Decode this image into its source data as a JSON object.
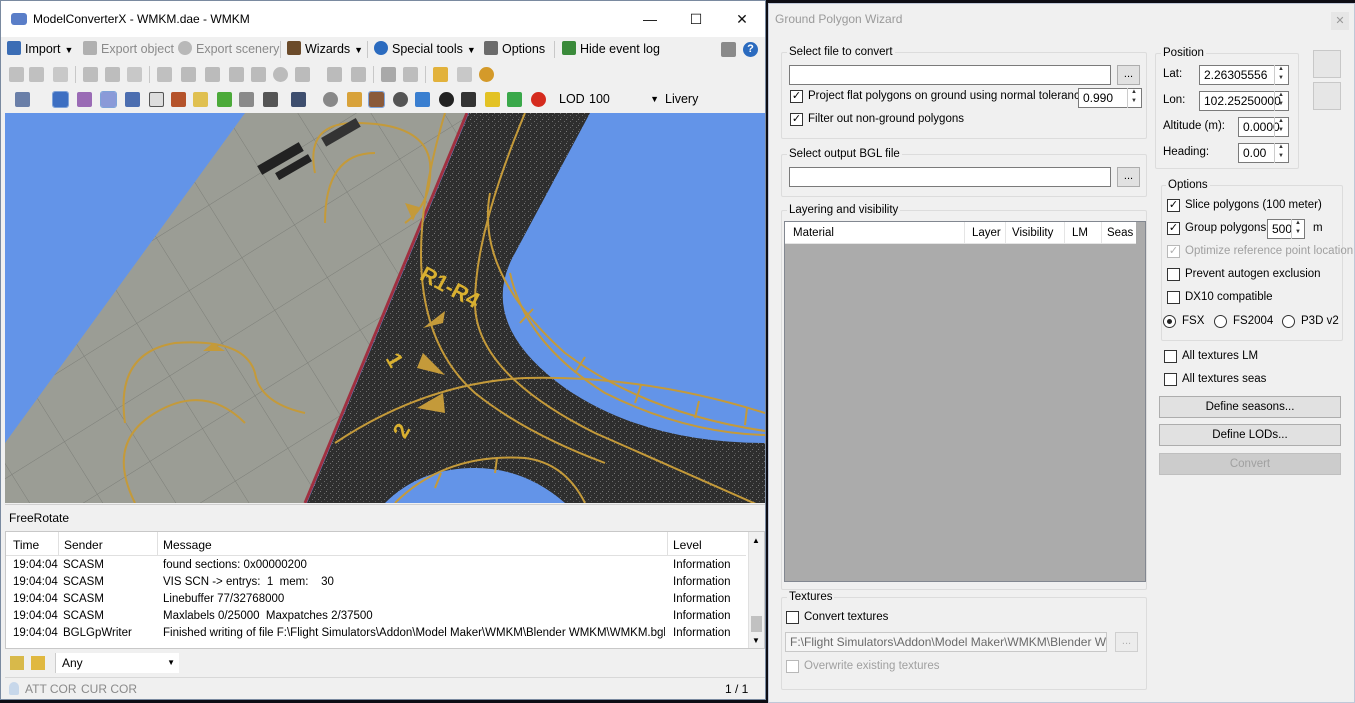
{
  "app": {
    "title": "ModelConverterX - WMKM.dae - WMKM",
    "menu": {
      "import": "Import",
      "export_object": "Export object",
      "export_scenery": "Export scenery",
      "wizards": "Wizards",
      "special_tools": "Special tools",
      "options": "Options",
      "hide_event_log": "Hide event log"
    },
    "lod_label": "LOD",
    "lod_value": "100",
    "livery_label": "Livery",
    "viewport_labels": {
      "runway_text": "R1-R4",
      "marker_1": "1",
      "marker_2": "2"
    },
    "freerotate": "FreeRotate",
    "log": {
      "columns": [
        "Time",
        "Sender",
        "Message",
        "Level"
      ],
      "rows": [
        {
          "time": "19:04:04",
          "sender": "SCASM",
          "message": "found sections: 0x00000200",
          "level": "Information"
        },
        {
          "time": "19:04:04",
          "sender": "SCASM",
          "message": "VIS SCN -> entrys:  1  mem:    30",
          "level": "Information"
        },
        {
          "time": "19:04:04",
          "sender": "SCASM",
          "message": "Linebuffer 77/32768000",
          "level": "Information"
        },
        {
          "time": "19:04:04",
          "sender": "SCASM",
          "message": "Maxlabels 0/25000  Maxpatches 2/37500",
          "level": "Information"
        },
        {
          "time": "19:04:04",
          "sender": "BGLGpWriter",
          "message": "Finished writing of file F:\\Flight Simulators\\Addon\\Model Maker\\WMKM\\Blender WMKM\\WMKM.bgl",
          "level": "Information"
        }
      ]
    },
    "filter_value": "Any",
    "status": {
      "att": "ATT COR",
      "cur": "CUR COR",
      "page": "1 / 1"
    }
  },
  "wizard": {
    "title": "Ground Polygon Wizard",
    "select_file": {
      "label": "Select file to convert",
      "value": "",
      "browse": "...",
      "project_flat": "Project flat polygons on ground using normal tolerance:",
      "project_flat_checked": true,
      "tolerance": "0.990",
      "filter_non_ground": "Filter out non-ground polygons",
      "filter_non_ground_checked": true
    },
    "output": {
      "label": "Select output BGL file",
      "value": "",
      "browse": "..."
    },
    "layering": {
      "label": "Layering and visibility",
      "columns": [
        "Material",
        "Layer",
        "Visibility",
        "LM",
        "Seas"
      ]
    },
    "textures": {
      "label": "Textures",
      "convert": "Convert textures",
      "path": "F:\\Flight Simulators\\Addon\\Model Maker\\WMKM\\Blender WMKM",
      "browse": "...",
      "overwrite": "Overwrite existing textures"
    },
    "position": {
      "label": "Position",
      "lat_label": "Lat:",
      "lat": "2.26305556",
      "lon_label": "Lon:",
      "lon": "102.25250000",
      "alt_label": "Altitude (m):",
      "alt": "0.0000",
      "heading_label": "Heading:",
      "heading": "0.00"
    },
    "options": {
      "label": "Options",
      "slice": "Slice polygons (100 meter)",
      "group": "Group polygons",
      "group_value": "500",
      "group_unit": "m",
      "optimize": "Optimize reference point location",
      "prevent_autogen": "Prevent autogen exclusion",
      "dx10": "DX10 compatible",
      "formats": [
        "FSX",
        "FS2004",
        "P3D v2"
      ],
      "selected_format": "FSX"
    },
    "all_lm": "All textures LM",
    "all_seas": "All textures seas",
    "define_seasons": "Define seasons...",
    "define_lods": "Define LODs...",
    "convert": "Convert"
  },
  "colors": {
    "sky": "#6394e8",
    "asphalt": "#2d2d2d",
    "concrete": "#9c9e96",
    "marking": "#c9a13c"
  }
}
